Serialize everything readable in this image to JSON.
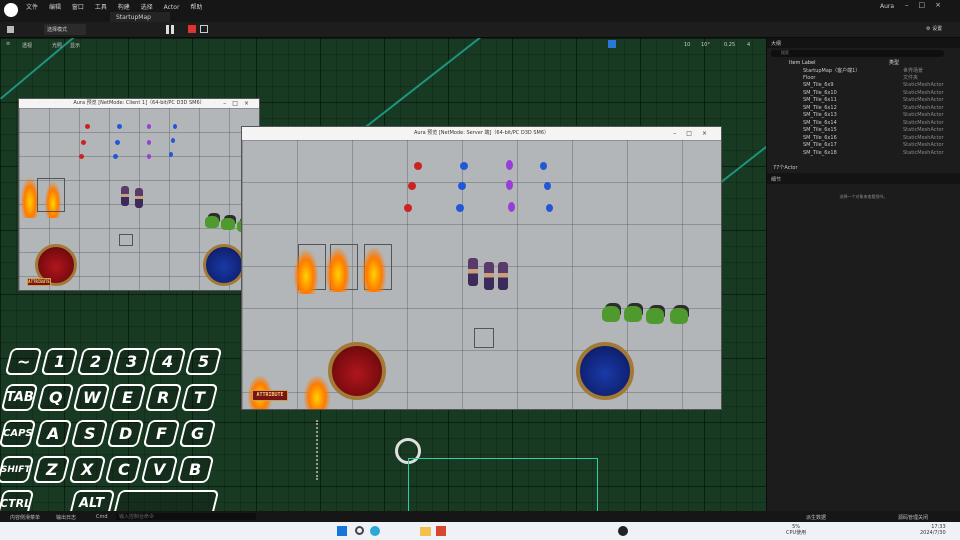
{
  "window": {
    "menus": [
      "文件",
      "编辑",
      "窗口",
      "工具",
      "构建",
      "选择",
      "Actor",
      "帮助"
    ],
    "tab": "StartupMap",
    "project": "Aura"
  },
  "toolbar": {
    "mode": "选择模式",
    "settings": "设置"
  },
  "viewport": {
    "perspective": "透视",
    "lit": "光照",
    "show": "显示",
    "grid_snap": "10",
    "rot_snap": "10°",
    "scale_snap": "0.25",
    "cam_speed": "4"
  },
  "outliner": {
    "tab": "大纲",
    "search_placeholder": "搜索",
    "col_label": "Item Label",
    "col_type": "类型",
    "rows": [
      {
        "name": "StartupMap（客户端1）",
        "type": "世界场景"
      },
      {
        "name": "Floor",
        "type": "文件夹"
      },
      {
        "name": "SM_Tile_6x9",
        "type": "StaticMeshActor"
      },
      {
        "name": "SM_Tile_6x10",
        "type": "StaticMeshActor"
      },
      {
        "name": "SM_Tile_6x11",
        "type": "StaticMeshActor"
      },
      {
        "name": "SM_Tile_6x12",
        "type": "StaticMeshActor"
      },
      {
        "name": "SM_Tile_6x13",
        "type": "StaticMeshActor"
      },
      {
        "name": "SM_Tile_6x14",
        "type": "StaticMeshActor"
      },
      {
        "name": "SM_Tile_6x15",
        "type": "StaticMeshActor"
      },
      {
        "name": "SM_Tile_6x16",
        "type": "StaticMeshActor"
      },
      {
        "name": "SM_Tile_6x17",
        "type": "StaticMeshActor"
      },
      {
        "name": "SM_Tile_6x18",
        "type": "StaticMeshActor"
      }
    ],
    "count": "77个Actor"
  },
  "details": {
    "tab": "细节",
    "empty_msg": "选择一个对象来查看细节。"
  },
  "pie_client": {
    "title": "Aura 预览 [NetMode: Client 1]（64-bit/PC D3D SM6）",
    "attribute": "ATTRIBUTE"
  },
  "pie_server": {
    "title": "Aura 预览 [NetMode: Server 端]（64-bit/PC D3D SM6）",
    "attribute": "ATTRIBUTE"
  },
  "statusbar": {
    "content_drawer": "内容侧滑菜单",
    "output_log": "输出日志",
    "cmd": "Cmd",
    "cmd_placeholder": "输入控制台命令",
    "derived_data": "派生数据",
    "source_control": "源码管理关闭"
  },
  "taskbar": {
    "cpu": "5%",
    "cpu_label": "CPU使用",
    "time": "17:33",
    "date": "2024/7/30"
  },
  "keyboard": {
    "row1": [
      "~",
      "1",
      "2",
      "3",
      "4",
      "5"
    ],
    "row2": [
      "TAB",
      "Q",
      "W",
      "E",
      "R",
      "T"
    ],
    "row3": [
      "CAPS",
      "A",
      "S",
      "D",
      "F",
      "G"
    ],
    "row4": [
      "SHIFT",
      "Z",
      "X",
      "C",
      "V",
      "B"
    ],
    "row5": [
      "CTRL",
      "ALT"
    ]
  },
  "colors": {
    "accent": "#1fbba6",
    "health_orb": "#b0161c",
    "mana_orb": "#1a3aa8"
  }
}
